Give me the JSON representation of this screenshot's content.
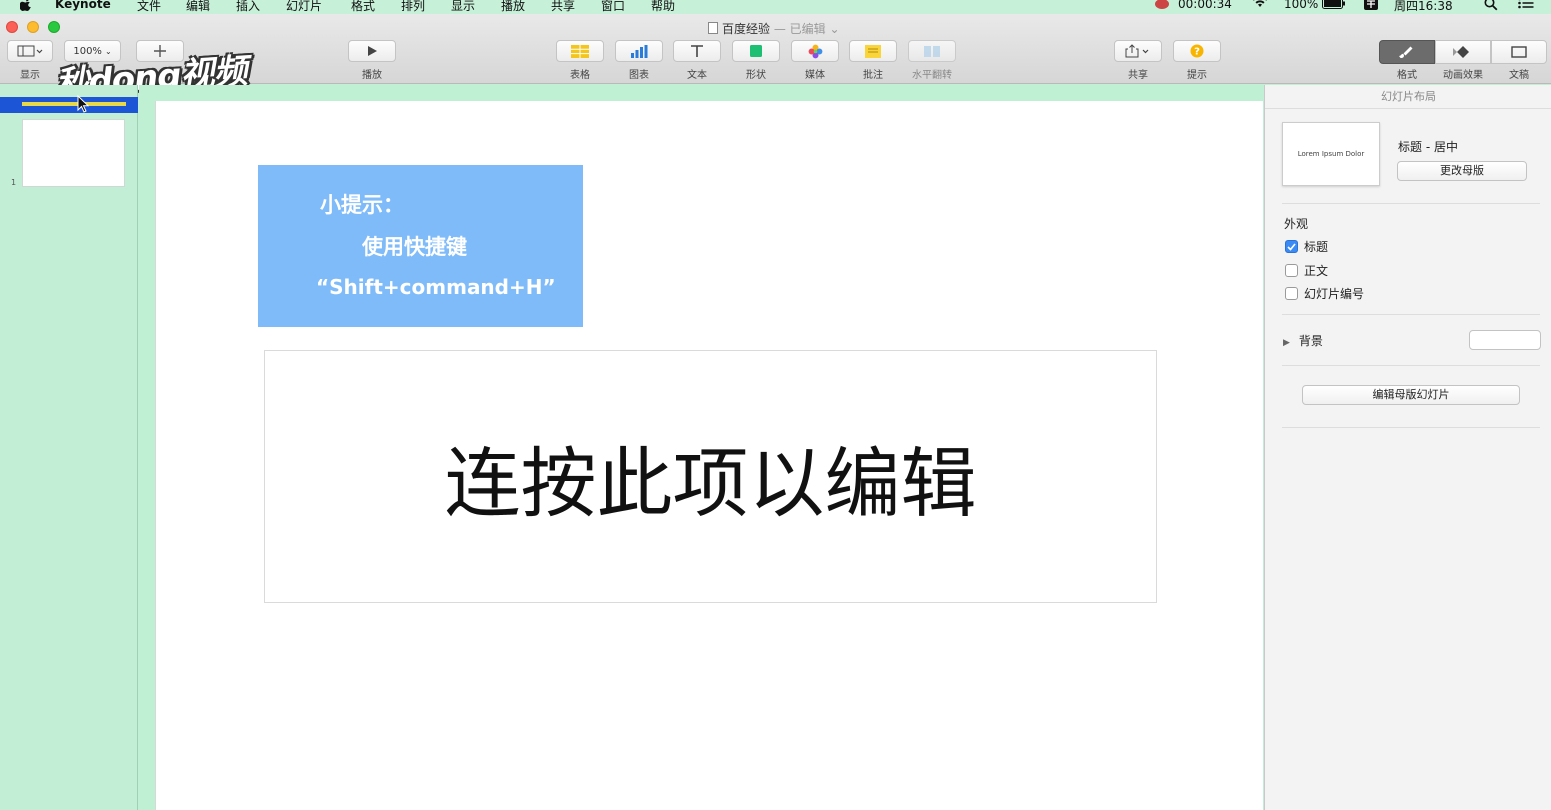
{
  "menubar": {
    "app_name": "Keynote",
    "items": [
      "文件",
      "编辑",
      "插入",
      "幻灯片",
      "格式",
      "排列",
      "显示",
      "播放",
      "共享",
      "窗口",
      "帮助"
    ],
    "recording_time": "00:00:34",
    "battery": "100%",
    "clock": "周四16:38"
  },
  "window": {
    "title": "百度经验",
    "edited_suffix": "— 已编辑 ⌄"
  },
  "toolbar": {
    "view_label": "显示",
    "zoom_value": "100%",
    "play_label": "播放",
    "table_label": "表格",
    "chart_label": "图表",
    "text_label": "文本",
    "shape_label": "形状",
    "media_label": "媒体",
    "comment_label": "批注",
    "flip_label": "水平翻转",
    "share_label": "共享",
    "tips_label": "提示",
    "format_label": "格式",
    "animate_label": "动画效果",
    "document_label": "文稿"
  },
  "watermark": {
    "text": "秒dong视频"
  },
  "navigator": {
    "slide_number": "1"
  },
  "slide": {
    "tip_line1": "小提示：",
    "tip_line2": "使用快捷键",
    "tip_line3": "“Shift+command+H”",
    "title_placeholder": "连按此项以编辑"
  },
  "inspector": {
    "header": "幻灯片布局",
    "layout_thumb_text": "Lorem Ipsum Dolor",
    "layout_name": "标题 - 居中",
    "change_master_button": "更改母版",
    "appearance_title": "外观",
    "checkbox_title": "标题",
    "checkbox_body": "正文",
    "checkbox_slide_number": "幻灯片编号",
    "background_label": "背景",
    "edit_master_button": "编辑母版幻灯片"
  },
  "colors": {
    "menubar_bg": "#c7f0d8",
    "tip_box": "#7fbbf9",
    "selection_blue": "#1c56d6",
    "navigator_bg": "#c2eed6"
  }
}
